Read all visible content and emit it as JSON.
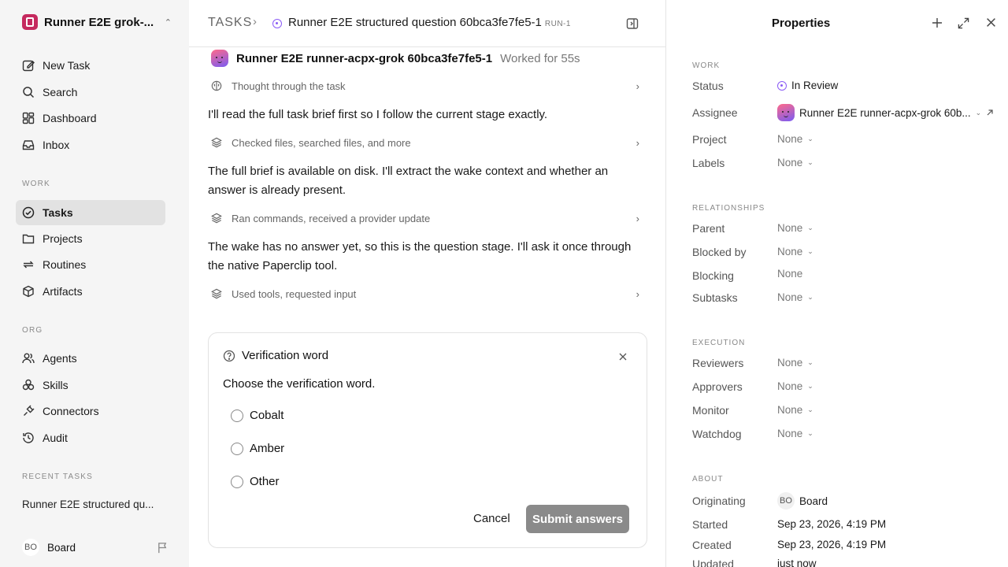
{
  "sidebar": {
    "workspace": "Runner E2E grok-...",
    "top_items": [
      {
        "label": "New Task",
        "icon": "pencil-square-icon"
      },
      {
        "label": "Search",
        "icon": "search-icon"
      },
      {
        "label": "Dashboard",
        "icon": "dashboard-icon"
      },
      {
        "label": "Inbox",
        "icon": "inbox-icon"
      }
    ],
    "work_label": "WORK",
    "work_items": [
      {
        "label": "Tasks",
        "icon": "check-circle-icon",
        "active": true
      },
      {
        "label": "Projects",
        "icon": "folder-icon"
      },
      {
        "label": "Routines",
        "icon": "repeat-icon"
      },
      {
        "label": "Artifacts",
        "icon": "box-icon"
      }
    ],
    "org_label": "ORG",
    "org_items": [
      {
        "label": "Agents",
        "icon": "users-icon"
      },
      {
        "label": "Skills",
        "icon": "skills-icon"
      },
      {
        "label": "Connectors",
        "icon": "plug-icon"
      },
      {
        "label": "Audit",
        "icon": "history-icon"
      }
    ],
    "recent_label": "RECENT TASKS",
    "recent_task": "Runner E2E structured qu...",
    "user": {
      "initials": "BO",
      "name": "Board"
    }
  },
  "header": {
    "section": "TASKS",
    "task_title": "Runner E2E structured question 60bca3fe7fe5-1",
    "run_label": "RUN-1"
  },
  "thread": {
    "agent_name": "Runner E2E runner-acpx-grok 60bca3fe7fe5-1",
    "worked_for": "Worked for 55s",
    "steps": [
      "Thought through the task",
      "Checked files, searched files, and more",
      "Ran commands, received a provider update",
      "Used tools, requested input"
    ],
    "messages": [
      "I'll read the full task brief first so I follow the current stage exactly.",
      "The full brief is available on disk. I'll extract the wake context and whether an answer is already present.",
      "The wake has no answer yet, so this is the question stage. I'll ask it once through the native Paperclip tool."
    ]
  },
  "question_card": {
    "title": "Verification word",
    "prompt": "Choose the verification word.",
    "options": [
      "Cobalt",
      "Amber",
      "Other"
    ],
    "cancel": "Cancel",
    "submit": "Submit answers"
  },
  "properties": {
    "title": "Properties",
    "work_label": "WORK",
    "status_label": "Status",
    "status_value": "In Review",
    "status_color": "#8b5cf6",
    "assignee_label": "Assignee",
    "assignee_value": "Runner E2E runner-acpx-grok 60b...",
    "project_label": "Project",
    "project_value": "None",
    "labels_label": "Labels",
    "labels_value": "None",
    "relationships_label": "RELATIONSHIPS",
    "parent_label": "Parent",
    "parent_value": "None",
    "blocked_by_label": "Blocked by",
    "blocked_by_value": "None",
    "blocking_label": "Blocking",
    "blocking_value": "None",
    "subtasks_label": "Subtasks",
    "subtasks_value": "None",
    "execution_label": "EXECUTION",
    "reviewers_label": "Reviewers",
    "reviewers_value": "None",
    "approvers_label": "Approvers",
    "approvers_value": "None",
    "monitor_label": "Monitor",
    "monitor_value": "None",
    "watchdog_label": "Watchdog",
    "watchdog_value": "None",
    "about_label": "ABOUT",
    "originating_label": "Originating",
    "originating_initials": "BO",
    "originating_value": "Board",
    "started_label": "Started",
    "started_value": "Sep 23, 2026, 4:19 PM",
    "created_label": "Created",
    "created_value": "Sep 23, 2026, 4:19 PM",
    "updated_label": "Updated",
    "updated_value": "just now"
  },
  "colors": {
    "accent": "#c5295e",
    "submit_disabled": "#8a8a8a",
    "status": "#8b5cf6"
  }
}
